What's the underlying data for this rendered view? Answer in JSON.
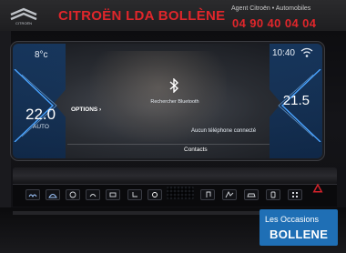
{
  "banner": {
    "dealer_name": "CITROËN LDA BOLLÈNE",
    "dealer_subline": "Agent Citroën • Automobiles",
    "phone": "04 90 40 04 04",
    "logo_text": "CITROËN"
  },
  "screen": {
    "outside_temp": "8°c",
    "clock": "10:40",
    "left_temp": "22.0",
    "left_mode": "AUTO",
    "right_temp": "21.5",
    "bluetooth_label": "Rechercher Bluetooth",
    "phone_status": "Aucun téléphone connecté",
    "options_label": "OPTIONS ›",
    "contacts_label": "Contacts"
  },
  "badge": {
    "line1": "Les Occasions",
    "line2": "BOLLENE"
  },
  "icons": {
    "bluetooth": "bluetooth-icon",
    "wifi": "wifi-icon",
    "hazard": "hazard-icon"
  },
  "colors": {
    "brand_red": "#e0262b",
    "panel_blue": "#163a66",
    "badge_blue": "#1f6fb5"
  }
}
